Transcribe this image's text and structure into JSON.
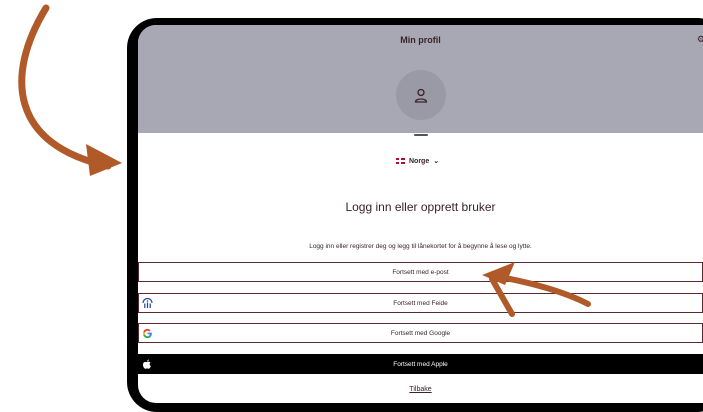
{
  "header": {
    "title": "Min profil",
    "settings_icon": "gear-icon",
    "band_color": "#a8a8b4"
  },
  "avatar": {
    "icon": "user-icon"
  },
  "country_selector": {
    "flag": "norway-flag-icon",
    "label": "Norge",
    "chevron": "chevron-down-icon"
  },
  "login": {
    "heading": "Logg inn eller opprett bruker",
    "subtitle": "Logg inn eller registrer deg og legg til lånekortet for å begynne å lese og lytte."
  },
  "buttons": {
    "email": "Fortsett med e-post",
    "feide": "Fortsett med Feide",
    "google": "Fortsett med Google",
    "apple": "Fortsett med Apple"
  },
  "back_link": "Tilbake",
  "colors": {
    "text": "#3a2329",
    "button_border": "#5a2a32",
    "annotation_arrow": "#b05a2a"
  }
}
